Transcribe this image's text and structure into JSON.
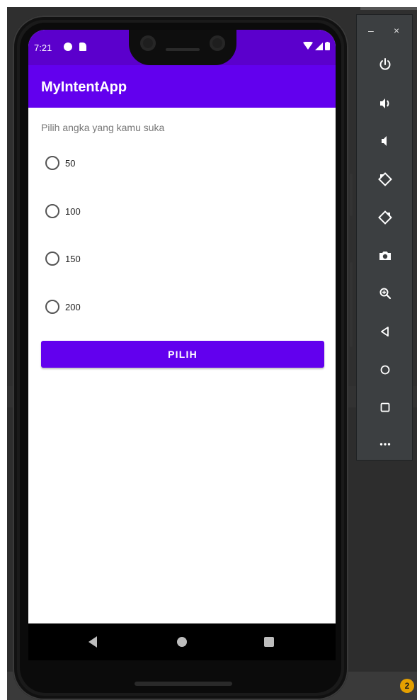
{
  "status_bar": {
    "time": "7:21"
  },
  "app_bar": {
    "title": "MyIntentApp"
  },
  "content": {
    "prompt": "Pilih angka yang kamu suka",
    "options": [
      {
        "label": "50",
        "selected": false
      },
      {
        "label": "100",
        "selected": false
      },
      {
        "label": "150",
        "selected": false
      },
      {
        "label": "200",
        "selected": false
      }
    ],
    "button_label": "PILIH"
  },
  "emulator_toolbar": {
    "window_controls": {
      "minimize": "–",
      "close": "×"
    },
    "buttons": [
      "power-icon",
      "volume-up-icon",
      "volume-down-icon",
      "rotate-left-icon",
      "rotate-right-icon",
      "camera-icon",
      "zoom-icon",
      "back-icon",
      "home-icon",
      "overview-icon",
      "more-icon"
    ]
  },
  "ide": {
    "notification_count": "2"
  },
  "colors": {
    "primary": "#6200ee",
    "primary_dark": "#5b00cc",
    "badge": "#e5a000"
  }
}
